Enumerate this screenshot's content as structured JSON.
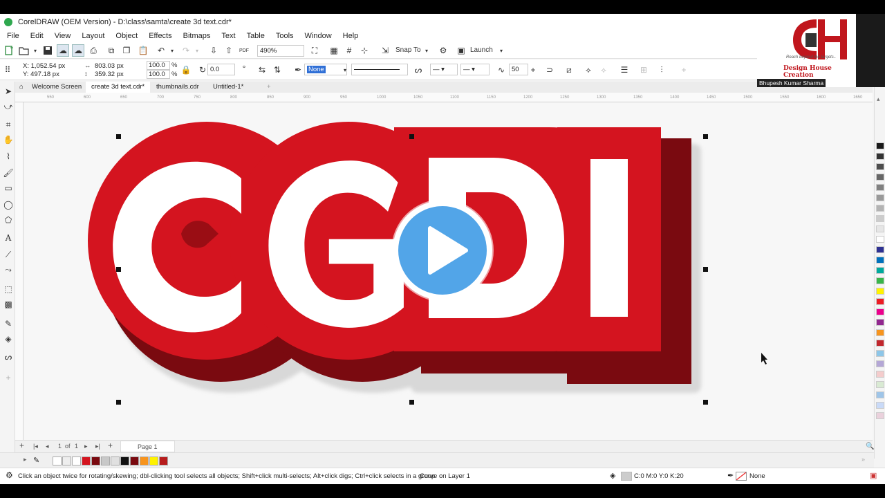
{
  "window": {
    "title": "CorelDRAW (OEM Version) - D:\\class\\samta\\create 3d text.cdr*"
  },
  "menu": [
    "File",
    "Edit",
    "View",
    "Layout",
    "Object",
    "Effects",
    "Bitmaps",
    "Text",
    "Table",
    "Tools",
    "Window",
    "Help"
  ],
  "toolbar": {
    "zoom": "490%",
    "snap_to": "Snap To",
    "launch": "Launch"
  },
  "property_bar": {
    "x": "X: 1,052.54 px",
    "y": "Y: 497.18 px",
    "width": "803.03 px",
    "height": "359.32 px",
    "scale_w": "100.0",
    "scale_h": "100.0",
    "scale_unit": "%",
    "rotation": "0.0",
    "outline_width": "None",
    "smoothing": "50"
  },
  "doc_tabs": [
    "Welcome Screen",
    "create 3d text.cdr*",
    "thumbnails.cdr",
    "Untitled-1*"
  ],
  "ruler_ticks": [
    "550",
    "600",
    "650",
    "700",
    "750",
    "800",
    "850",
    "900",
    "950",
    "1000",
    "1050",
    "1100",
    "1150",
    "1200",
    "1250",
    "1300",
    "1350",
    "1400",
    "1450",
    "1500",
    "1550",
    "1600",
    "1650"
  ],
  "artwork": {
    "text": "CGDI",
    "face_color": "#d4141f",
    "extrude_color": "#7a0a10",
    "inner_color": "#ffffff"
  },
  "page_nav": {
    "position": "1",
    "of": "of",
    "total": "1",
    "page_tab": "Page 1"
  },
  "palette_colors": [
    "#1a1a1a",
    "#333333",
    "#4d4d4d",
    "#666666",
    "#808080",
    "#999999",
    "#b3b3b3",
    "#cccccc",
    "#e6e6e6",
    "#ffffff",
    "#2e3192",
    "#0071bc",
    "#00a99d",
    "#39b54a",
    "#fff200",
    "#ed1c24",
    "#ec008c",
    "#92278f",
    "#f7941d",
    "#c1272d",
    "#8dc6e8",
    "#b4a7d6",
    "#f4cccc",
    "#d9ead3",
    "#9fc5e8",
    "#c9daf8",
    "#ead1dc"
  ],
  "doc_palette": [
    "#ffffff",
    "#eeeeee",
    "#ffffff",
    "#d4141f",
    "#7a0a10",
    "#c8c8c8",
    "#e0e0e0",
    "#111111",
    "#7a0a10",
    "#f7941d",
    "#fff200",
    "#b71c1c"
  ],
  "status": {
    "hint": "Click an object twice for rotating/skewing; dbl-clicking tool selects all objects; Shift+click multi-selects; Alt+click digs; Ctrl+click selects in a group",
    "layer": "Curve on Layer 1",
    "fill": "C:0 M:0 Y:0 K:20",
    "outline": "None"
  },
  "webcam": {
    "presenter": "Bhupesh Kumar Sharma",
    "tagline": "Reach beyond the targets..",
    "brand": "Design House Creation",
    "logo_letters": "CH"
  }
}
